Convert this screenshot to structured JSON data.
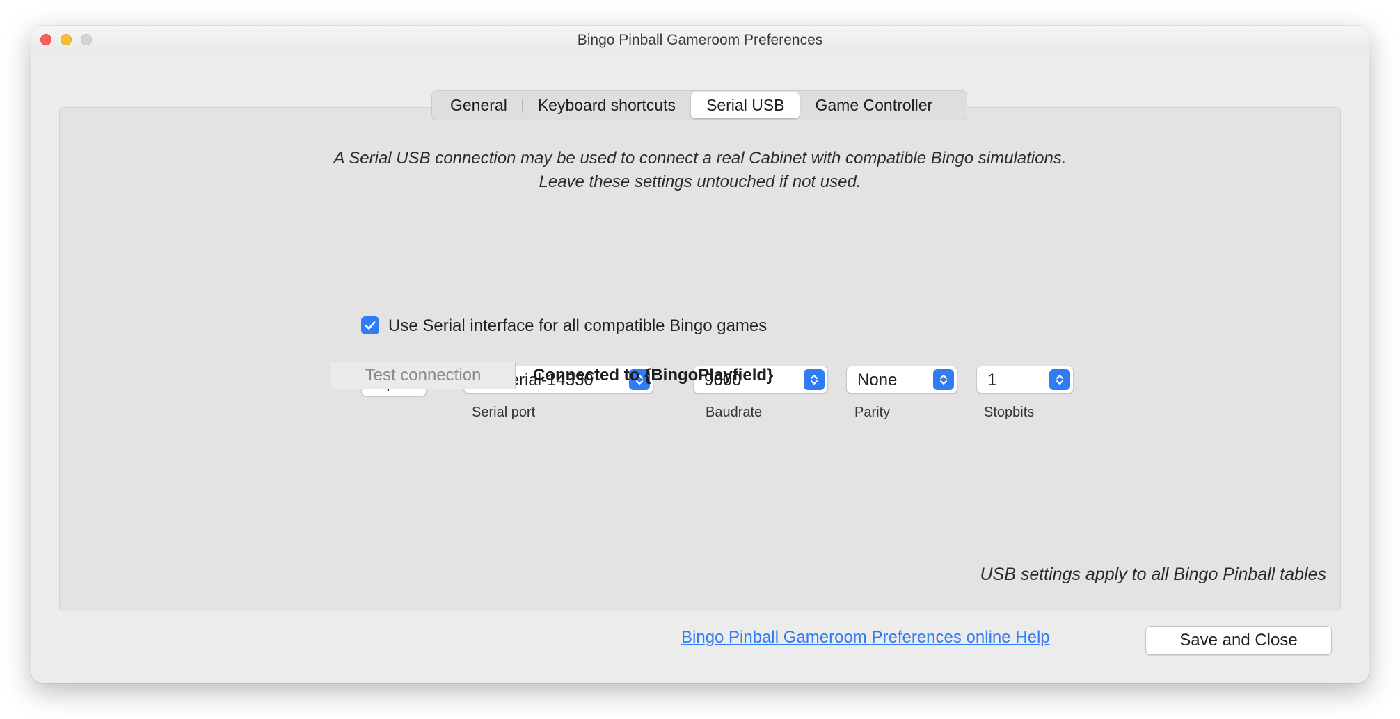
{
  "window": {
    "title": "Bingo Pinball Gameroom Preferences"
  },
  "tabs": [
    {
      "label": "General",
      "active": false
    },
    {
      "label": "Keyboard shortcuts",
      "active": false
    },
    {
      "label": "Serial USB",
      "active": true
    },
    {
      "label": "Game Controller",
      "active": false
    }
  ],
  "serial_usb": {
    "intro_line1": "A Serial USB connection may be used to connect a real Cabinet with compatible Bingo simulations.",
    "intro_line2": "Leave these settings untouched if not used.",
    "use_serial": {
      "label": "Use Serial interface for all compatible Bingo games",
      "checked": true
    },
    "open_button": "Open",
    "serial_port": {
      "value": "usbserial-14330",
      "label": "Serial port"
    },
    "baudrate": {
      "value": "9600",
      "label": "Baudrate"
    },
    "parity": {
      "value": "None",
      "label": "Parity"
    },
    "stopbits": {
      "value": "1",
      "label": "Stopbits"
    },
    "test_button": "Test connection",
    "status": "Connected to {BingoPlayfield}",
    "footnote": "USB settings apply to all Bingo Pinball tables"
  },
  "footer": {
    "help_link": "Bingo Pinball Gameroom Preferences online Help",
    "save_button": "Save and Close"
  },
  "colors": {
    "accent": "#2f7cf6",
    "close": "#ff5f57",
    "minimize": "#febc2e",
    "maximize_disabled": "#d3d3d3"
  },
  "icons": [
    "close-icon",
    "minimize-icon",
    "maximize-icon",
    "checkmark-icon",
    "updown-chevron-icon"
  ]
}
